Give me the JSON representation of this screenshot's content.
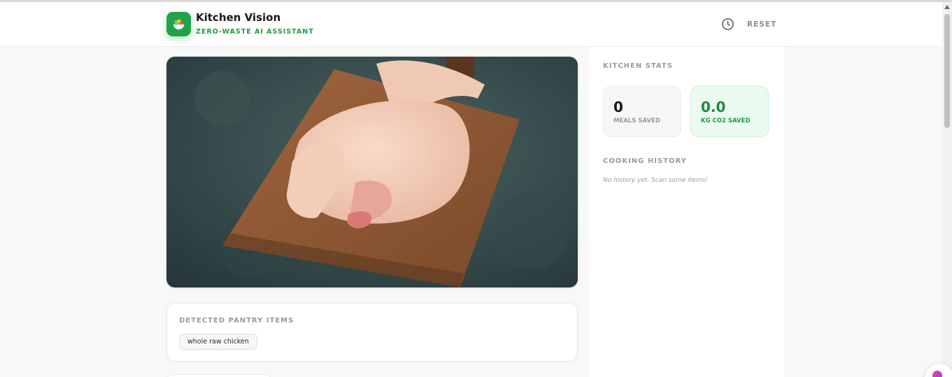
{
  "header": {
    "title": "Kitchen Vision",
    "subtitle": "ZERO-WASTE AI ASSISTANT",
    "history_icon": "clock-icon",
    "reset_label": "RESET",
    "logo_icon": "salad-bowl-icon"
  },
  "main": {
    "image_subject": "whole raw chicken on wooden cutting board",
    "detected": {
      "heading": "DETECTED PANTRY ITEMS",
      "items": [
        {
          "label": "whole raw chicken"
        }
      ]
    }
  },
  "sidebar": {
    "stats_heading": "KITCHEN STATS",
    "stats": [
      {
        "value": "0",
        "label": "MEALS SAVED"
      },
      {
        "value": "0.0",
        "label": "KG CO2 SAVED"
      }
    ],
    "history_heading": "COOKING HISTORY",
    "history_empty": "No history yet. Scan some items!"
  },
  "colors": {
    "brand_green": "#21a34a",
    "accent_green_text": "#1f9b45",
    "muted_text": "#9a9a9a",
    "page_bg": "#f8f8f7"
  }
}
